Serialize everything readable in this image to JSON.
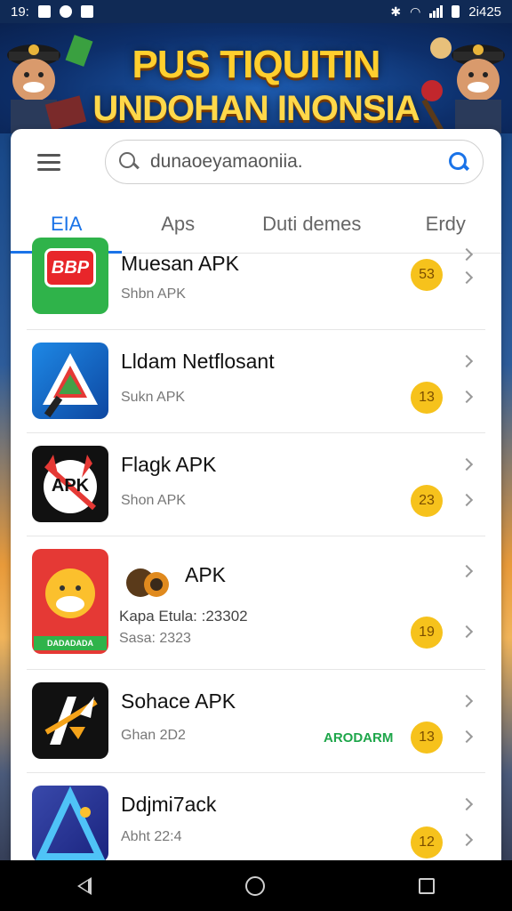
{
  "status_bar": {
    "time": "19:",
    "right_text": "2i425",
    "icons": [
      "notification-square-icon",
      "circle-icon",
      "square-icon",
      "bluetooth-icon",
      "wifi-icon",
      "signal-icon",
      "battery-icon"
    ]
  },
  "banner": {
    "title": "PUS TIQUITIN",
    "subtitle": "UNDOHAN INONSIA"
  },
  "search": {
    "value": "dunaoeyamaoniia."
  },
  "tabs": [
    {
      "label": "EIA",
      "active": true
    },
    {
      "label": "Aps",
      "active": false
    },
    {
      "label": "Duti demes",
      "active": false
    },
    {
      "label": "Erdy",
      "active": false
    }
  ],
  "apps": [
    {
      "name": "Muesan APK",
      "sub": "Shbn APK",
      "badge": "53",
      "icon": "red-chat-logo-icon",
      "icon_text": "BBP"
    },
    {
      "name": "Lldam Netflosant",
      "sub": "Sukn APK",
      "badge": "13",
      "icon": "triangle-logo-icon"
    },
    {
      "name": "Flagk APK",
      "sub": "Shon APK",
      "badge": "23",
      "icon": "apk-cat-logo-icon",
      "icon_text": "APK"
    },
    {
      "name": "APK",
      "sub": "Kapa Etula: :23302",
      "sub2": "Sasa: 2323",
      "badge": "19",
      "icon": "laughing-face-logo-icon",
      "icon_text": "DADADADA"
    },
    {
      "name": "Sohace APK",
      "sub": "Ghan 2D2",
      "badge": "13",
      "icon": "av-logo-icon",
      "verified": "ARODARM"
    },
    {
      "name": "Ddjmi7ack",
      "sub": "Abht 22:4",
      "badge": "12",
      "icon": "blue-triangle-logo-icon"
    }
  ],
  "colors": {
    "accent": "#1a73e8",
    "badge": "#f6c21c",
    "verified": "#1ea64a"
  }
}
